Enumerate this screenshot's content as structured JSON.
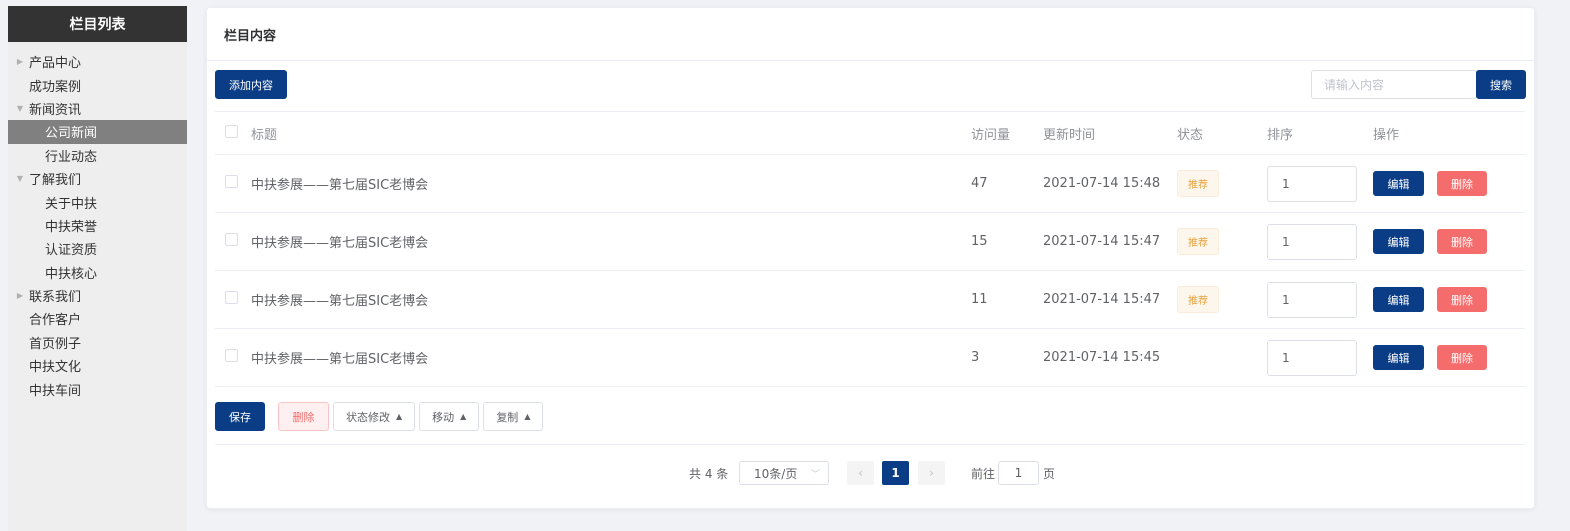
{
  "sidebar": {
    "title": "栏目列表",
    "items": [
      {
        "label": "产品中心",
        "level": 1,
        "arrow": "right"
      },
      {
        "label": "成功案例",
        "level": 1,
        "arrow": ""
      },
      {
        "label": "新闻资讯",
        "level": 1,
        "arrow": "down"
      },
      {
        "label": "公司新闻",
        "level": 2,
        "arrow": "",
        "active": true
      },
      {
        "label": "行业动态",
        "level": 2,
        "arrow": ""
      },
      {
        "label": "了解我们",
        "level": 1,
        "arrow": "down"
      },
      {
        "label": "关于中扶",
        "level": 2,
        "arrow": ""
      },
      {
        "label": "中扶荣誉",
        "level": 2,
        "arrow": ""
      },
      {
        "label": "认证资质",
        "level": 2,
        "arrow": ""
      },
      {
        "label": "中扶核心",
        "level": 2,
        "arrow": ""
      },
      {
        "label": "联系我们",
        "level": 1,
        "arrow": "right"
      },
      {
        "label": "合作客户",
        "level": 1,
        "arrow": ""
      },
      {
        "label": "首页例子",
        "level": 1,
        "arrow": ""
      },
      {
        "label": "中扶文化",
        "level": 1,
        "arrow": ""
      },
      {
        "label": "中扶车间",
        "level": 1,
        "arrow": ""
      }
    ]
  },
  "main": {
    "title": "栏目内容",
    "add_label": "添加内容",
    "search_placeholder": "请输入内容",
    "search_label": "搜索"
  },
  "table": {
    "headers": {
      "title": "标题",
      "visits": "访问量",
      "updated": "更新时间",
      "status": "状态",
      "sort": "排序",
      "ops": "操作"
    },
    "rows": [
      {
        "title": "中扶参展——第七届SIC老博会",
        "visits": "47",
        "updated": "2021-07-14 15:48",
        "status": "推荐",
        "sort": "1"
      },
      {
        "title": "中扶参展——第七届SIC老博会",
        "visits": "15",
        "updated": "2021-07-14 15:47",
        "status": "推荐",
        "sort": "1"
      },
      {
        "title": "中扶参展——第七届SIC老博会",
        "visits": "11",
        "updated": "2021-07-14 15:47",
        "status": "推荐",
        "sort": "1"
      },
      {
        "title": "中扶参展——第七届SIC老博会",
        "visits": "3",
        "updated": "2021-07-14 15:45",
        "status": "",
        "sort": "1"
      }
    ],
    "edit_label": "编辑",
    "delete_label": "删除"
  },
  "actions": {
    "save_label": "保存",
    "delete_label": "删除",
    "status_label": "状态修改",
    "move_label": "移动",
    "copy_label": "复制"
  },
  "pagination": {
    "total": "共 4 条",
    "page_size": "10条/页",
    "current_page": "1",
    "goto_prefix": "前往",
    "goto_value": "1",
    "goto_suffix": "页"
  },
  "colors": {
    "primary": "#0b3d86",
    "danger": "#f56c6c",
    "warning": "#e6a23c",
    "sidebar_header": "#333333",
    "sidebar_active": "#808080"
  }
}
